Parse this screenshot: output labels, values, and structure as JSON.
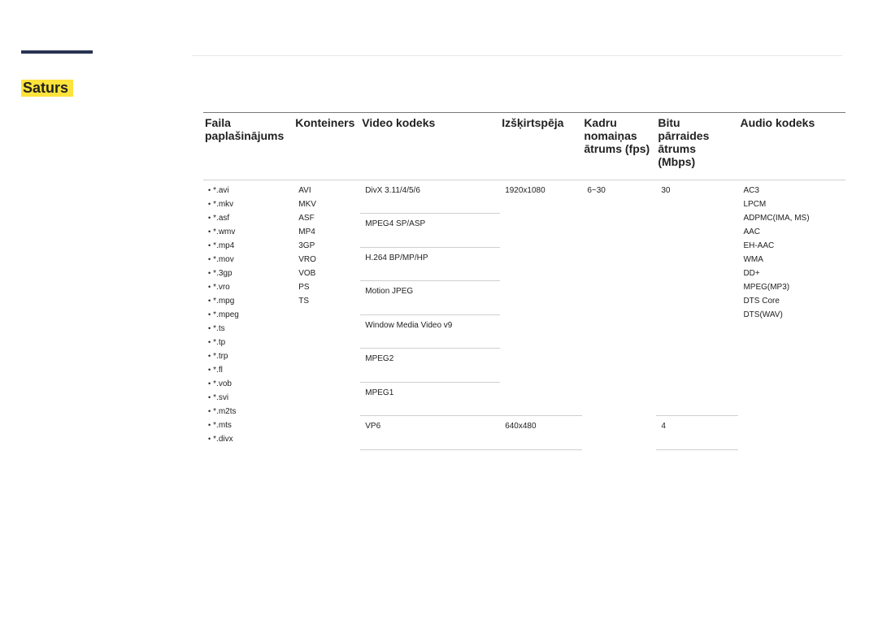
{
  "section_title": "Saturs",
  "headers": {
    "ext": "Faila paplašinājums",
    "container": "Konteiners",
    "codec": "Video kodeks",
    "resolution": "Izšķirtspēja",
    "fps": "Kadru nomaiņas ātrums (fps)",
    "bitrate": "Bitu pārraides ātrums (Mbps)",
    "audio": "Audio kodeks"
  },
  "extensions": [
    "*.avi",
    "*.mkv",
    "*.asf",
    "*.wmv",
    "*.mp4",
    "*.mov",
    "*.3gp",
    "*.vro",
    "*.mpg",
    "*.mpeg",
    "*.ts",
    "*.tp",
    "*.trp",
    "*.fl",
    "*.vob",
    "*.svi",
    "*.m2ts",
    "*.mts",
    "*.divx"
  ],
  "containers": [
    "AVI",
    "MKV",
    "ASF",
    "MP4",
    "3GP",
    "VRO",
    "VOB",
    "PS",
    "TS"
  ],
  "audio_codecs": [
    "AC3",
    "LPCM",
    "ADPMC(IMA, MS)",
    "AAC",
    "EH-AAC",
    "WMA",
    "DD+",
    "MPEG(MP3)",
    "DTS Core",
    "DTS(WAV)"
  ],
  "rows": [
    {
      "codec": "DivX 3.11/4/5/6",
      "res": "1920x1080",
      "fps": "6~30",
      "bitrate": "30"
    },
    {
      "codec": "MPEG4 SP/ASP",
      "res": "",
      "fps": "",
      "bitrate": ""
    },
    {
      "codec": "H.264 BP/MP/HP",
      "res": "",
      "fps": "",
      "bitrate": ""
    },
    {
      "codec": "Motion JPEG",
      "res": "",
      "fps": "",
      "bitrate": ""
    },
    {
      "codec": "Window Media Video v9",
      "res": "",
      "fps": "",
      "bitrate": ""
    },
    {
      "codec": "MPEG2",
      "res": "",
      "fps": "",
      "bitrate": ""
    },
    {
      "codec": "MPEG1",
      "res": "",
      "fps": "",
      "bitrate": ""
    },
    {
      "codec": "VP6",
      "res": "640x480",
      "fps": "",
      "bitrate": "4"
    }
  ]
}
